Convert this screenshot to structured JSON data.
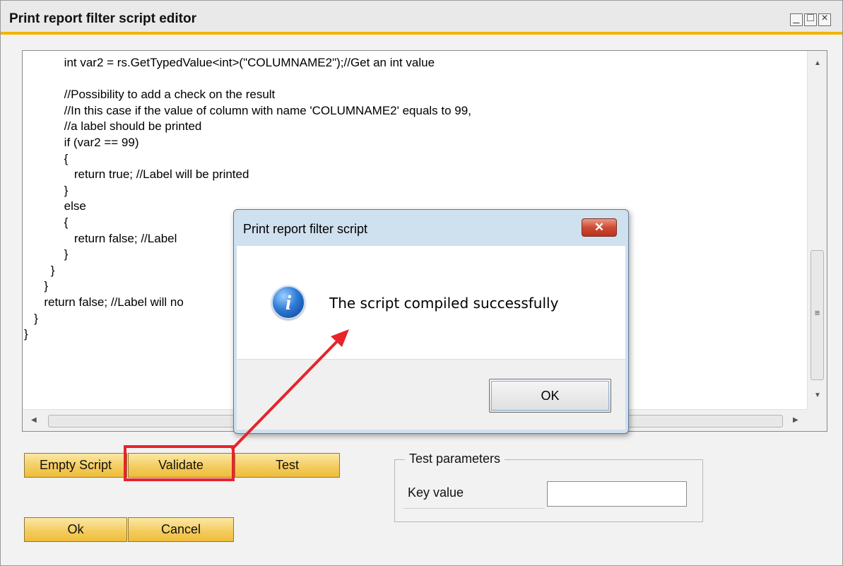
{
  "window": {
    "title": "Print report filter script editor"
  },
  "editor": {
    "code": "            int var2 = rs.GetTypedValue<int>(\"COLUMNAME2\");//Get an int value\n\n            //Possibility to add a check on the result\n            //In this case if the value of column with name 'COLUMNAME2' equals to 99,\n            //a label should be printed\n            if (var2 == 99)\n            {\n               return true; //Label will be printed\n            }\n            else\n            {\n               return false; //Label\n            }\n        }\n      }\n      return false; //Label will no\n   }\n}"
  },
  "buttons": {
    "empty_script": "Empty Script",
    "validate": "Validate",
    "test": "Test",
    "ok": "Ok",
    "cancel": "Cancel"
  },
  "test_parameters": {
    "legend": "Test parameters",
    "key_label": "Key value",
    "key_value": ""
  },
  "dialog": {
    "title": "Print report filter script",
    "message": "The script compiled successfully",
    "ok_label": "OK",
    "icon": "info-icon"
  },
  "annotation": {
    "color": "#e8232b"
  },
  "colors": {
    "accent_bar": "#f3b300",
    "button_yellow": "#f4cd60"
  }
}
